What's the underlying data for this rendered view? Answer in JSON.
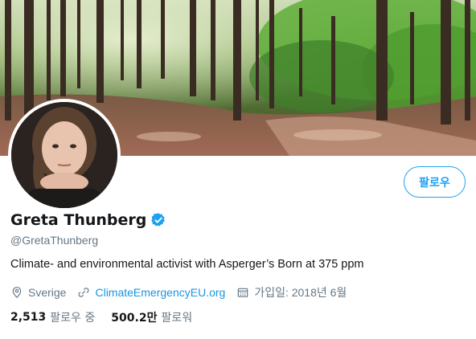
{
  "profile": {
    "name": "Greta Thunberg",
    "handle": "@GretaThunberg",
    "bio": "Climate- and environmental activist with Asperger’s  Born at 375 ppm",
    "location": "Sverige",
    "website": "ClimateEmergencyEU.org",
    "joined": "가입일: 2018년 6월",
    "verified": true
  },
  "actions": {
    "follow_label": "팔로우"
  },
  "stats": {
    "following_count": "2,513",
    "following_label": "팔로우 중",
    "followers_count": "500.2만",
    "followers_label": "팔로워"
  },
  "colors": {
    "accent": "#1da1f2",
    "link": "#1b95e0",
    "secondary_text": "#657786",
    "primary_text": "#14171a"
  },
  "icons": {
    "location": "location-pin-icon",
    "website": "link-icon",
    "joined": "calendar-icon",
    "verified": "verified-badge-icon"
  }
}
